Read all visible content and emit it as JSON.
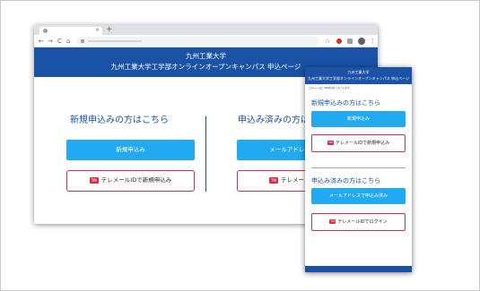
{
  "banner": {
    "line1": "九州工業大学",
    "line2": "九州工業大学工学部オンラインオープンキャンパス 申込ページ"
  },
  "new_applicant": {
    "title": "新規申込みの方はこちら",
    "primary_label": "新規申込み",
    "telemail_label": "テレメールIDで新規申込み"
  },
  "existing_applicant": {
    "title": "申込み済みの方はこちら",
    "primary_label": "メールアドレスで申込み済み",
    "telemail_label": "テレメールIDでログイン"
  },
  "browser": {
    "new_tab": "+",
    "nav_icons": [
      "←",
      "→",
      "C",
      "⌂"
    ]
  },
  "mobile": {
    "notice": "このページは、SSL暗号化 されています。",
    "primary_existing_label": "メールアドレスで申込み済み"
  },
  "telemail_logo_text": "TM",
  "colors": {
    "brand_blue": "#1a52a6",
    "button_blue": "#22a9f0",
    "outline_red": "#d9304a"
  }
}
